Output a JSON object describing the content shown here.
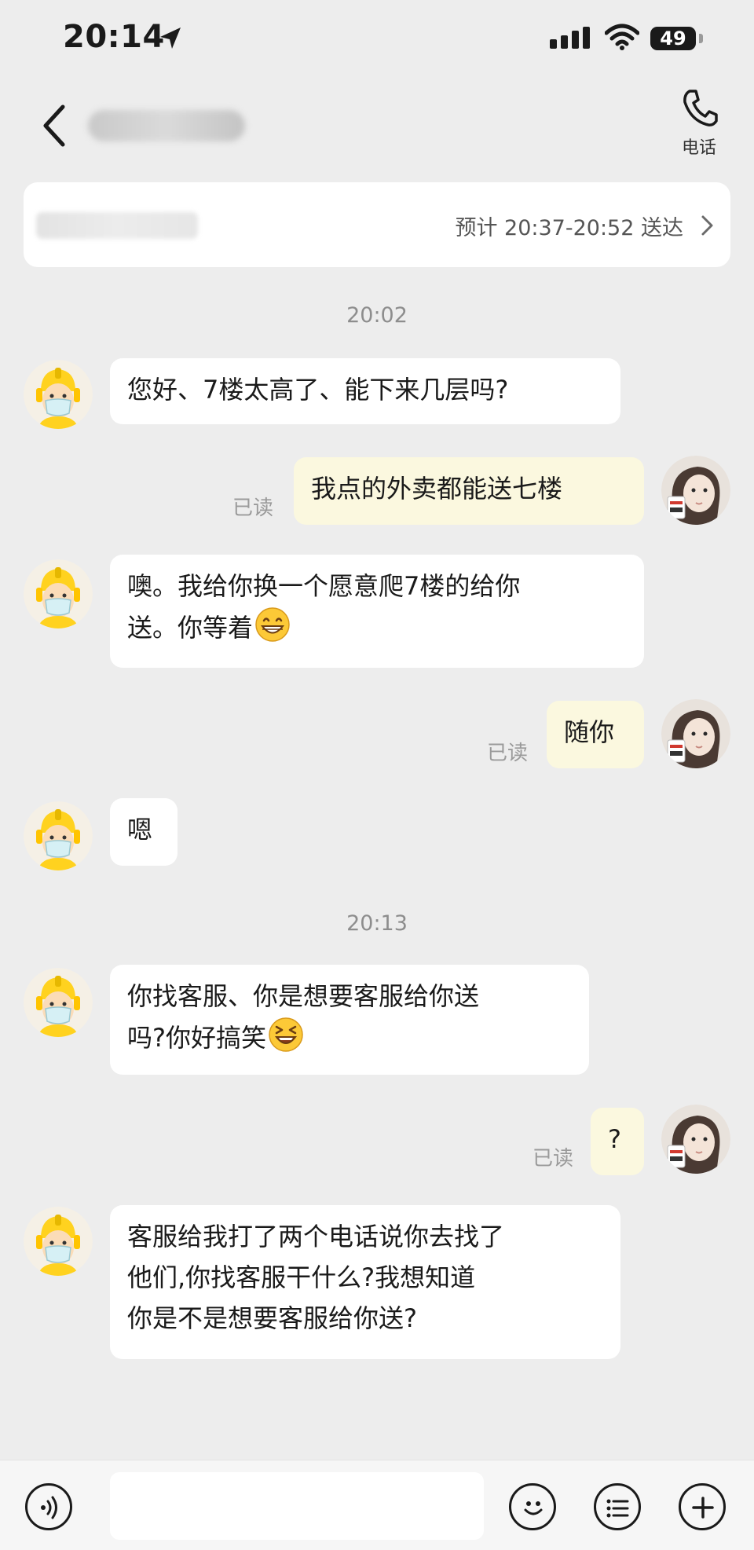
{
  "status_bar": {
    "time": "20:14",
    "battery": "49"
  },
  "header": {
    "call_label": "电话"
  },
  "delivery": {
    "eta": "预计 20:37-20:52 送达"
  },
  "timestamps": [
    "20:02",
    "20:13"
  ],
  "messages": [
    {
      "side": "left",
      "lines": [
        "您好、7楼太高了、能下来几层吗?"
      ]
    },
    {
      "side": "right",
      "lines": [
        "我点的外卖都能送七楼"
      ],
      "read": "已读"
    },
    {
      "side": "left",
      "lines": [
        "噢。我给你换一个愿意爬7楼的给你",
        "送。你等着"
      ],
      "emoji": "grin"
    },
    {
      "side": "right",
      "lines": [
        "随你"
      ],
      "read": "已读"
    },
    {
      "side": "left",
      "lines": [
        "嗯"
      ]
    },
    {
      "side": "left",
      "lines": [
        "你找客服、你是想要客服给你送",
        "吗?你好搞笑"
      ],
      "emoji": "laugh"
    },
    {
      "side": "right",
      "lines": [
        "?"
      ],
      "read": "已读"
    },
    {
      "side": "left",
      "lines": [
        "客服给我打了两个电话说你去找了",
        "他们,你找客服干什么?我想知道",
        "你是不是想要客服给你送?"
      ]
    }
  ],
  "input": {
    "placeholder": ""
  },
  "icons": {
    "back": "chevron-left-icon",
    "call": "phone-icon",
    "voice": "voice-icon",
    "emoji": "smile-icon",
    "menu": "menu-icon",
    "plus": "plus-icon"
  }
}
